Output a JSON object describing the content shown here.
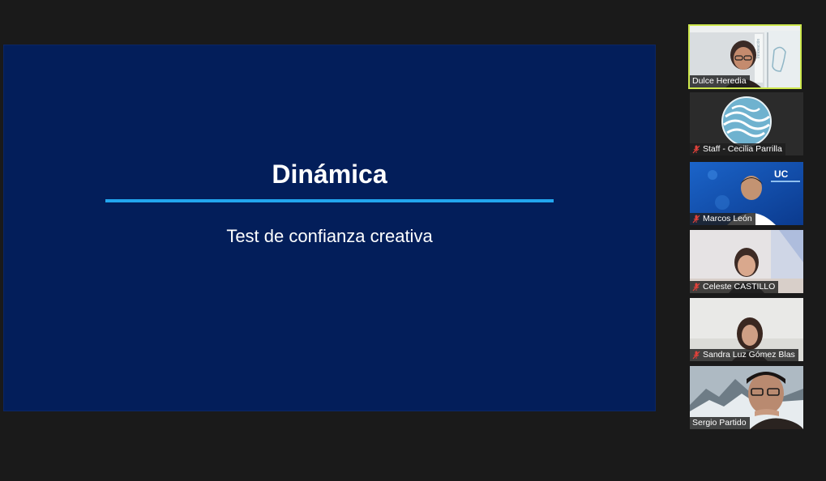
{
  "slide": {
    "title": "Dinámica",
    "subtitle": "Test de confianza creativa"
  },
  "participants": [
    {
      "name": "Dulce Heredia",
      "muted": false,
      "active_speaker": true
    },
    {
      "name": "Staff - Cecilia Parrilla",
      "muted": true,
      "active_speaker": false
    },
    {
      "name": "Marcos León",
      "muted": true,
      "active_speaker": false
    },
    {
      "name": "Celeste CASTILLO",
      "muted": true,
      "active_speaker": false
    },
    {
      "name": "Sandra Luz Gómez Blas",
      "muted": true,
      "active_speaker": false
    },
    {
      "name": "Sergio Partido",
      "muted": false,
      "active_speaker": false
    }
  ],
  "colors": {
    "background": "#1a1a1a",
    "slide_background": "#031e5a",
    "slide_accent": "#22a6ee",
    "active_speaker_border": "#cde74d",
    "muted_icon": "#e0413a"
  }
}
